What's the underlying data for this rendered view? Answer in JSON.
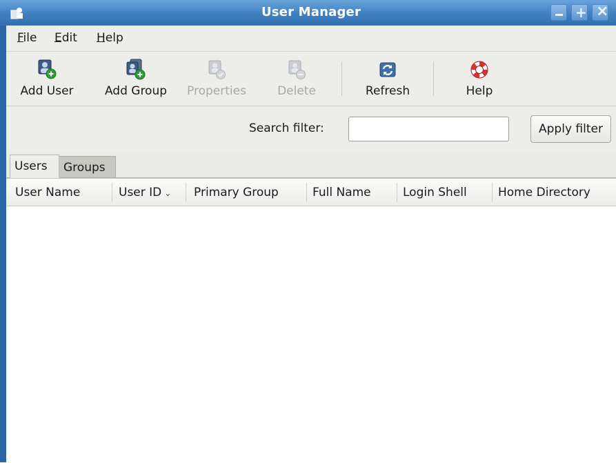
{
  "window": {
    "title": "User Manager"
  },
  "menubar": {
    "items": [
      {
        "label": "File",
        "mnemonic": "F"
      },
      {
        "label": "Edit",
        "mnemonic": "E"
      },
      {
        "label": "Help",
        "mnemonic": "H"
      }
    ]
  },
  "toolbar": {
    "buttons": [
      {
        "label": "Add User",
        "icon": "add-user-icon",
        "enabled": true
      },
      {
        "label": "Add Group",
        "icon": "add-group-icon",
        "enabled": true
      },
      {
        "label": "Properties",
        "icon": "properties-icon",
        "enabled": false
      },
      {
        "label": "Delete",
        "icon": "delete-icon",
        "enabled": false
      },
      {
        "label": "Refresh",
        "icon": "refresh-icon",
        "enabled": true
      },
      {
        "label": "Help",
        "icon": "help-lifebuoy-icon",
        "enabled": true
      }
    ]
  },
  "search": {
    "label": "Search filter:",
    "value": "",
    "apply_label": "Apply filter"
  },
  "tabs": [
    {
      "label": "Users",
      "active": true
    },
    {
      "label": "Groups",
      "active": false
    }
  ],
  "table": {
    "columns": [
      {
        "label": "User Name"
      },
      {
        "label": "User ID",
        "sorted": "descending",
        "sort_glyph": "⌄"
      },
      {
        "label": "Primary Group"
      },
      {
        "label": "Full Name"
      },
      {
        "label": "Login Shell"
      },
      {
        "label": "Home Directory"
      }
    ],
    "rows": []
  },
  "colors": {
    "titlebar": "#3f7fc0",
    "window_border": "#2a66a6",
    "chrome_bg": "#ededea",
    "add_badge": "#2e9b3a"
  }
}
